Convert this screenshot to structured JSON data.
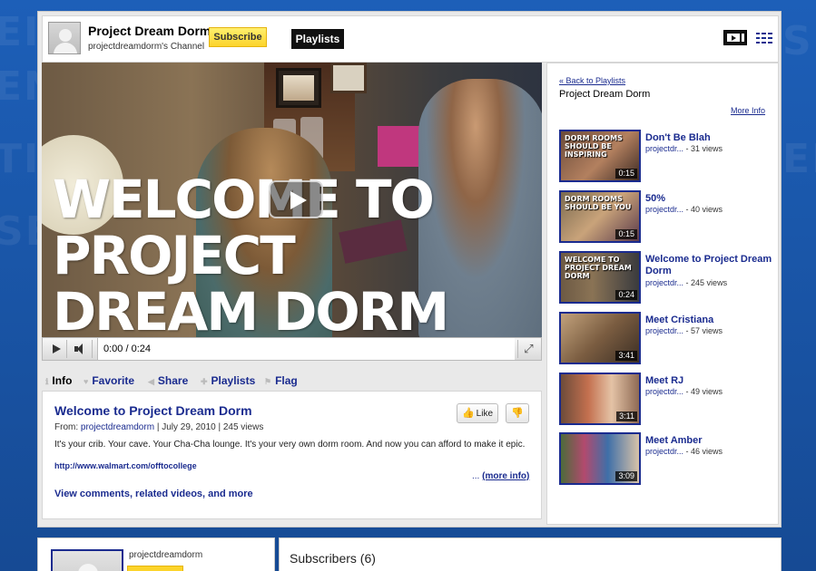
{
  "channel": {
    "title": "Project Dream Dorm",
    "subtitle": "projectdreamdorm's Channel",
    "subscribe_label": "Subscribe",
    "tab_label": "Playlists"
  },
  "player": {
    "overlay_text_line1": "WELCOME TO",
    "overlay_text_line2": "PROJECT",
    "overlay_text_line3": "DREAM DORM",
    "time": "0:00 / 0:24",
    "play_icon": "play-icon",
    "volume_icon": "volume-icon",
    "fullscreen_icon": "fullscreen-icon"
  },
  "tabs": [
    {
      "label": "Info",
      "active": true
    },
    {
      "label": "Favorite"
    },
    {
      "label": "Share"
    },
    {
      "label": "Playlists"
    },
    {
      "label": "Flag"
    }
  ],
  "video": {
    "title": "Welcome to Project Dream Dorm",
    "from_prefix": "From:",
    "author": "projectdreamdorm",
    "date_views": "| July 29, 2010 | 245 views",
    "like_label": "Like",
    "description": "It's your crib. Your cave. Your Cha-Cha lounge. It's your very own dorm room. And now you can afford to make it epic.",
    "url": "http://www.walmart.com/offtocollege",
    "more_prefix": "...",
    "more_label": "(more info)",
    "comments_link": "View comments, related videos, and more"
  },
  "playlist": {
    "back_label": "« Back to Playlists",
    "title": "Project Dream Dorm",
    "more_info": "More Info",
    "items": [
      {
        "name": "Don't Be Blah",
        "author": "projectdr...",
        "views": "- 31 views",
        "duration": "0:15",
        "thumb_text": "DORM ROOMS SHOULD BE INSPIRING",
        "bg": "linear-gradient(135deg,#6b4b3a,#b3805f 55%,#3d2b24)"
      },
      {
        "name": "50%",
        "author": "projectdr...",
        "views": "- 40 views",
        "duration": "0:15",
        "thumb_text": "DORM ROOMS SHOULD BE YOU",
        "bg": "linear-gradient(135deg,#7a6a50,#c9a37a 50%,#5b3a4a)"
      },
      {
        "name": "Welcome to Project Dream Dorm",
        "author": "projectdr...",
        "views": "- 245 views",
        "duration": "0:24",
        "thumb_text": "WELCOME TO PROJECT DREAM DORM",
        "bg": "linear-gradient(90deg,#6d5a44,#8a7355 40%,#3a3b3e)"
      },
      {
        "name": "Meet Cristiana",
        "author": "projectdr...",
        "views": "- 57 views",
        "duration": "3:41",
        "thumb_text": "",
        "bg": "linear-gradient(135deg,#c2a27c,#7b5d41 50%,#3b2e24)"
      },
      {
        "name": "Meet RJ",
        "author": "projectdr...",
        "views": "- 49 views",
        "duration": "3:11",
        "thumb_text": "",
        "bg": "linear-gradient(90deg,#6d4c3a,#c4704f 35%,#e4c3a6 65%,#8e6a54)"
      },
      {
        "name": "Meet Amber",
        "author": "projectdr...",
        "views": "- 46 views",
        "duration": "3:09",
        "thumb_text": "",
        "bg": "linear-gradient(90deg,#4c6b3a,#b24a6e 30%,#3f6fa8 60%,#d8c2a8)"
      }
    ]
  },
  "bottom": {
    "username": "projectdreamdorm",
    "subscribers": "Subscribers (6)"
  }
}
